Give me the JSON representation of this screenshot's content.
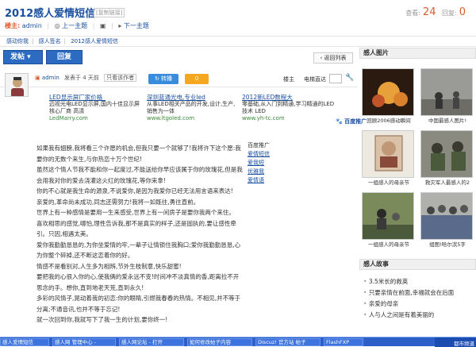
{
  "page": {
    "title": "2012感人爱情短信",
    "copy_link": "[复制链接]"
  },
  "stats": {
    "views_label": "查看:",
    "views": "24",
    "replies_label": "回复:",
    "replies": "0"
  },
  "subline": {
    "author_label": "楼主:",
    "author": "admin",
    "prev": "上一主题",
    "next": "下一主题"
  },
  "breadcrumb": [
    "感动你我",
    "感人签名",
    "2012感人爱情短信"
  ],
  "buttons": {
    "post": "发帖",
    "reply": "回复",
    "back": "返回列表"
  },
  "post": {
    "author": "admin",
    "posted": "发表于 4 天前",
    "only_author": "只看该作者",
    "share": "转播",
    "count": "0",
    "floor": "楼主",
    "e_label": "电梯直达"
  },
  "ads": [
    {
      "title": "LED显示屏厂家价格_",
      "body": "迈视光电LED显示屏,国内十佳显示屏核心厂商 高清",
      "url": "LedMarry.com"
    },
    {
      "title": "深圳蓝通光电,专业led",
      "body": "从事LED相关产品的开发,设计,生产,销售为一体",
      "url": "www.ltgoled.com"
    },
    {
      "title": "2012新LED数程大",
      "body": "零基础,从入门到精通,学习精通的LED技术 LED",
      "url": "www.yh-tc.com"
    }
  ],
  "baidu_label": "百度推广",
  "side_ads": {
    "heading": "百度推广",
    "items": [
      "爱情短信",
      "爱我短",
      "优雅我",
      "爱情语"
    ]
  },
  "content": [
    "如果我有翅膀,我将看三个许愿的机会,但我只要一个就够了!我将许下这个愿:我要你的无数个来生,与你热恋十万个世纪!",
    "虽然这个情人节我不能和你一起度过,不能送给你早应该属于你的玫瑰花,但是我会用我对你的爱去浇灌这火红的玫瑰花,等你来拿!",
    "你的不心就是我生命的源泉,不说爱你,是因为我爱你已经无法用言语来表达!",
    "亲爱的,革命尚未成功,同志还需努力!我将一如既往,勇往直前。",
    "世界上有一种感情是要用一生来感受,世界上有一间房子是要你我两个来住。",
    "喜欢相思的感觉,哪怕,理性告诉我,那不是真实的样子,还是固执的,要让感性牵引。只因,相遇太美。",
    "爱你我勤勤恳恳的,为你坐爱情的牢,一辈子让情锁住我胸口;爱你我勤勤恳恳,心为你整个碎掉,还不断这恋着你的好。",
    "情感不是看别对,人生多为相辨,节外生枝制意,快乐甜蜜!",
    "要把我的心很入你的心,使我俩的爱永远不变!时间冲不淡真情的香,距离拉不开思念的手。想你,直到地老天荒,直到永久!",
    "多彩的风情子,晃动着我的初恋:你的眼睛,引燃我春春的热情。不相见,并不等于分离;不通音讯,也并不等于忘记!",
    "就一次回到你,我就写下了我一生的计划,要你终一!"
  ],
  "right": {
    "pics_heading": "感人图片",
    "story_heading": "感人故事"
  },
  "thumbs": [
    {
      "caption": "回顾2006感动瞬间"
    },
    {
      "caption": "中国最感人图片!"
    },
    {
      "caption": "一组感人的母亲节"
    },
    {
      "caption": "救灾军人最感人的2"
    },
    {
      "caption": "一组感人的母亲节"
    },
    {
      "caption": "组图!哈尔滨5字"
    }
  ],
  "stories": [
    "3.5米长的救英",
    "只要亲情在前面,幸福就会在后面",
    "亲爱的母亲",
    "人与人之间是有着美丽的"
  ],
  "taskbar": {
    "items": [
      "感人爱情短信",
      "感人网 管理中心 -",
      "感人网论坛 - 打开",
      "如何修改帖子内容",
      "Discuz! 官方站 帖子",
      "FlashFXP"
    ],
    "clock": "都市频道"
  }
}
